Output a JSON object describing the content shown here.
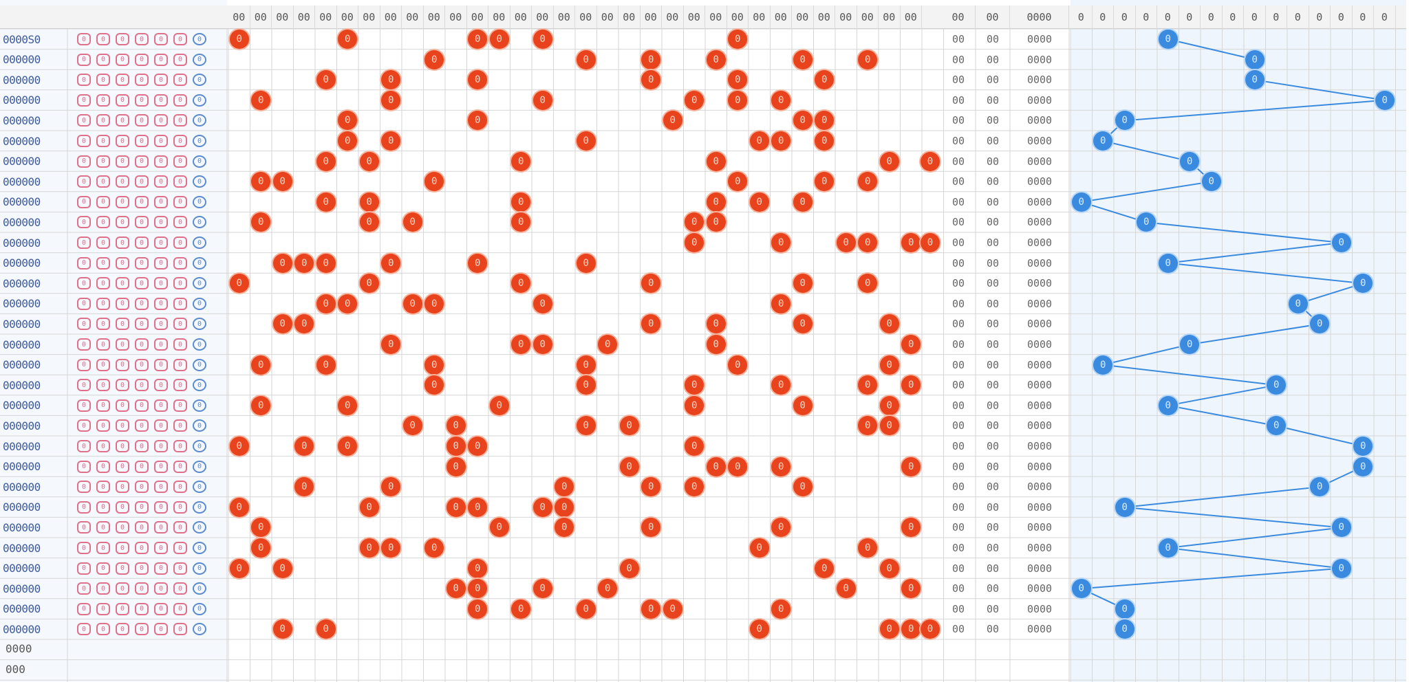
{
  "header": {
    "red_cols": 32,
    "blue_cols": 16,
    "left_labels": [
      "",
      ""
    ],
    "stat_labels": [
      "00",
      "00",
      "0000"
    ]
  },
  "rows": [
    {
      "label": "0000S0",
      "codes": [
        "0",
        "0",
        "0",
        "0",
        "0",
        "0",
        "0"
      ],
      "red": [
        1,
        6,
        12,
        13,
        15,
        24
      ],
      "stat": [
        "00",
        "00",
        "0000"
      ],
      "blue": 5
    },
    {
      "label": "000000",
      "codes": [
        "0",
        "0",
        "0",
        "0",
        "0",
        "0",
        "0"
      ],
      "red": [
        10,
        17,
        20,
        23,
        27,
        30
      ],
      "stat": [
        "00",
        "00",
        "0000"
      ],
      "blue": 9
    },
    {
      "label": "000000",
      "codes": [
        "0",
        "0",
        "0",
        "0",
        "0",
        "0",
        "0"
      ],
      "red": [
        5,
        8,
        12,
        20,
        24,
        28
      ],
      "stat": [
        "00",
        "00",
        "0000"
      ],
      "blue": 9
    },
    {
      "label": "000000",
      "codes": [
        "0",
        "0",
        "0",
        "0",
        "0",
        "0",
        "0"
      ],
      "red": [
        2,
        8,
        15,
        22,
        24,
        26
      ],
      "stat": [
        "00",
        "00",
        "0000"
      ],
      "blue": 15
    },
    {
      "label": "000000",
      "codes": [
        "0",
        "0",
        "0",
        "0",
        "0",
        "0",
        "0"
      ],
      "red": [
        6,
        12,
        21,
        27,
        28,
        28
      ],
      "stat": [
        "00",
        "00",
        "0000"
      ],
      "blue": 3
    },
    {
      "label": "000000",
      "codes": [
        "0",
        "0",
        "0",
        "0",
        "0",
        "0",
        "0"
      ],
      "red": [
        6,
        8,
        17,
        25,
        26,
        28
      ],
      "stat": [
        "00",
        "00",
        "0000"
      ],
      "blue": 2
    },
    {
      "label": "000000",
      "codes": [
        "0",
        "0",
        "0",
        "0",
        "0",
        "0",
        "0"
      ],
      "red": [
        5,
        7,
        14,
        23,
        31,
        33
      ],
      "stat": [
        "00",
        "00",
        "0000"
      ],
      "blue": 6
    },
    {
      "label": "000000",
      "codes": [
        "0",
        "0",
        "0",
        "0",
        "0",
        "0",
        "0"
      ],
      "red": [
        2,
        3,
        10,
        24,
        28,
        30
      ],
      "stat": [
        "00",
        "00",
        "0000"
      ],
      "blue": 7
    },
    {
      "label": "000000",
      "codes": [
        "0",
        "0",
        "0",
        "0",
        "0",
        "0",
        "0"
      ],
      "red": [
        5,
        7,
        14,
        23,
        25,
        27
      ],
      "stat": [
        "00",
        "00",
        "0000"
      ],
      "blue": 1
    },
    {
      "label": "000000",
      "codes": [
        "0",
        "0",
        "0",
        "0",
        "0",
        "0",
        "0"
      ],
      "red": [
        2,
        7,
        9,
        14,
        22,
        23
      ],
      "stat": [
        "00",
        "00",
        "0000"
      ],
      "blue": 4
    },
    {
      "label": "000000",
      "codes": [
        "0",
        "0",
        "0",
        "0",
        "0",
        "0",
        "0"
      ],
      "red": [
        22,
        26,
        29,
        30,
        32,
        33
      ],
      "stat": [
        "00",
        "00",
        "0000"
      ],
      "blue": 13
    },
    {
      "label": "000000",
      "codes": [
        "0",
        "0",
        "0",
        "0",
        "0",
        "0",
        "0"
      ],
      "red": [
        3,
        4,
        5,
        8,
        12,
        17
      ],
      "stat": [
        "00",
        "00",
        "0000"
      ],
      "blue": 5
    },
    {
      "label": "000000",
      "codes": [
        "0",
        "0",
        "0",
        "0",
        "0",
        "0",
        "0"
      ],
      "red": [
        1,
        7,
        14,
        20,
        27,
        30
      ],
      "stat": [
        "00",
        "00",
        "0000"
      ],
      "blue": 14
    },
    {
      "label": "000000",
      "codes": [
        "0",
        "0",
        "0",
        "0",
        "0",
        "0",
        "0"
      ],
      "red": [
        5,
        6,
        9,
        10,
        15,
        26
      ],
      "stat": [
        "00",
        "00",
        "0000"
      ],
      "blue": 11
    },
    {
      "label": "000000",
      "codes": [
        "0",
        "0",
        "0",
        "0",
        "0",
        "0",
        "0"
      ],
      "red": [
        3,
        4,
        20,
        23,
        27,
        31
      ],
      "stat": [
        "00",
        "00",
        "0000"
      ],
      "blue": 12
    },
    {
      "label": "000000",
      "codes": [
        "0",
        "0",
        "0",
        "0",
        "0",
        "0",
        "0"
      ],
      "red": [
        8,
        14,
        15,
        18,
        23,
        32
      ],
      "stat": [
        "00",
        "00",
        "0000"
      ],
      "blue": 6
    },
    {
      "label": "000000",
      "codes": [
        "0",
        "0",
        "0",
        "0",
        "0",
        "0",
        "0"
      ],
      "red": [
        2,
        5,
        10,
        17,
        24,
        31
      ],
      "stat": [
        "00",
        "00",
        "0000"
      ],
      "blue": 2
    },
    {
      "label": "000000",
      "codes": [
        "0",
        "0",
        "0",
        "0",
        "0",
        "0",
        "0"
      ],
      "red": [
        10,
        17,
        22,
        26,
        30,
        32
      ],
      "stat": [
        "00",
        "00",
        "0000"
      ],
      "blue": 10
    },
    {
      "label": "000000",
      "codes": [
        "0",
        "0",
        "0",
        "0",
        "0",
        "0",
        "0"
      ],
      "red": [
        2,
        6,
        13,
        22,
        27,
        31
      ],
      "stat": [
        "00",
        "00",
        "0000"
      ],
      "blue": 5
    },
    {
      "label": "000000",
      "codes": [
        "0",
        "0",
        "0",
        "0",
        "0",
        "0",
        "0"
      ],
      "red": [
        9,
        11,
        17,
        19,
        30,
        31
      ],
      "stat": [
        "00",
        "00",
        "0000"
      ],
      "blue": 10
    },
    {
      "label": "000000",
      "codes": [
        "0",
        "0",
        "0",
        "0",
        "0",
        "0",
        "0"
      ],
      "red": [
        1,
        4,
        6,
        11,
        12,
        22
      ],
      "stat": [
        "00",
        "00",
        "0000"
      ],
      "blue": 14
    },
    {
      "label": "000000",
      "codes": [
        "0",
        "0",
        "0",
        "0",
        "0",
        "0",
        "0"
      ],
      "red": [
        11,
        19,
        23,
        24,
        26,
        32
      ],
      "stat": [
        "00",
        "00",
        "0000"
      ],
      "blue": 14
    },
    {
      "label": "000000",
      "codes": [
        "0",
        "0",
        "0",
        "0",
        "0",
        "0",
        "0"
      ],
      "red": [
        4,
        8,
        16,
        20,
        22,
        27
      ],
      "stat": [
        "00",
        "00",
        "0000"
      ],
      "blue": 12
    },
    {
      "label": "000000",
      "codes": [
        "0",
        "0",
        "0",
        "0",
        "0",
        "0",
        "0"
      ],
      "red": [
        1,
        7,
        11,
        12,
        15,
        16
      ],
      "stat": [
        "00",
        "00",
        "0000"
      ],
      "blue": 3
    },
    {
      "label": "000000",
      "codes": [
        "0",
        "0",
        "0",
        "0",
        "0",
        "0",
        "0"
      ],
      "red": [
        2,
        13,
        16,
        20,
        26,
        32
      ],
      "stat": [
        "00",
        "00",
        "0000"
      ],
      "blue": 13
    },
    {
      "label": "000000",
      "codes": [
        "0",
        "0",
        "0",
        "0",
        "0",
        "0",
        "0"
      ],
      "red": [
        2,
        7,
        8,
        10,
        25,
        30
      ],
      "stat": [
        "00",
        "00",
        "0000"
      ],
      "blue": 5
    },
    {
      "label": "000000",
      "codes": [
        "0",
        "0",
        "0",
        "0",
        "0",
        "0",
        "0"
      ],
      "red": [
        1,
        3,
        12,
        19,
        28,
        31
      ],
      "stat": [
        "00",
        "00",
        "0000"
      ],
      "blue": 13
    },
    {
      "label": "000000",
      "codes": [
        "0",
        "0",
        "0",
        "0",
        "0",
        "0",
        "0"
      ],
      "red": [
        11,
        12,
        15,
        18,
        29,
        32
      ],
      "stat": [
        "00",
        "00",
        "0000"
      ],
      "blue": 1
    },
    {
      "label": "000000",
      "codes": [
        "0",
        "0",
        "0",
        "0",
        "0",
        "0",
        "0"
      ],
      "red": [
        12,
        14,
        17,
        20,
        21,
        26
      ],
      "stat": [
        "00",
        "00",
        "0000"
      ],
      "blue": 3
    },
    {
      "label": "000000",
      "codes": [
        "0",
        "0",
        "0",
        "0",
        "0",
        "0",
        "0"
      ],
      "red": [
        3,
        5,
        25,
        31,
        32,
        33
      ],
      "stat": [
        "00",
        "00",
        "0000"
      ],
      "blue": 3
    }
  ],
  "footer": {
    "label1": "0000",
    "label2": "000"
  },
  "colors": {
    "red": "#e8431c",
    "blue": "#3a8ae0",
    "grid": "#d6d6d6",
    "blue_bg": "#eef5fc"
  }
}
